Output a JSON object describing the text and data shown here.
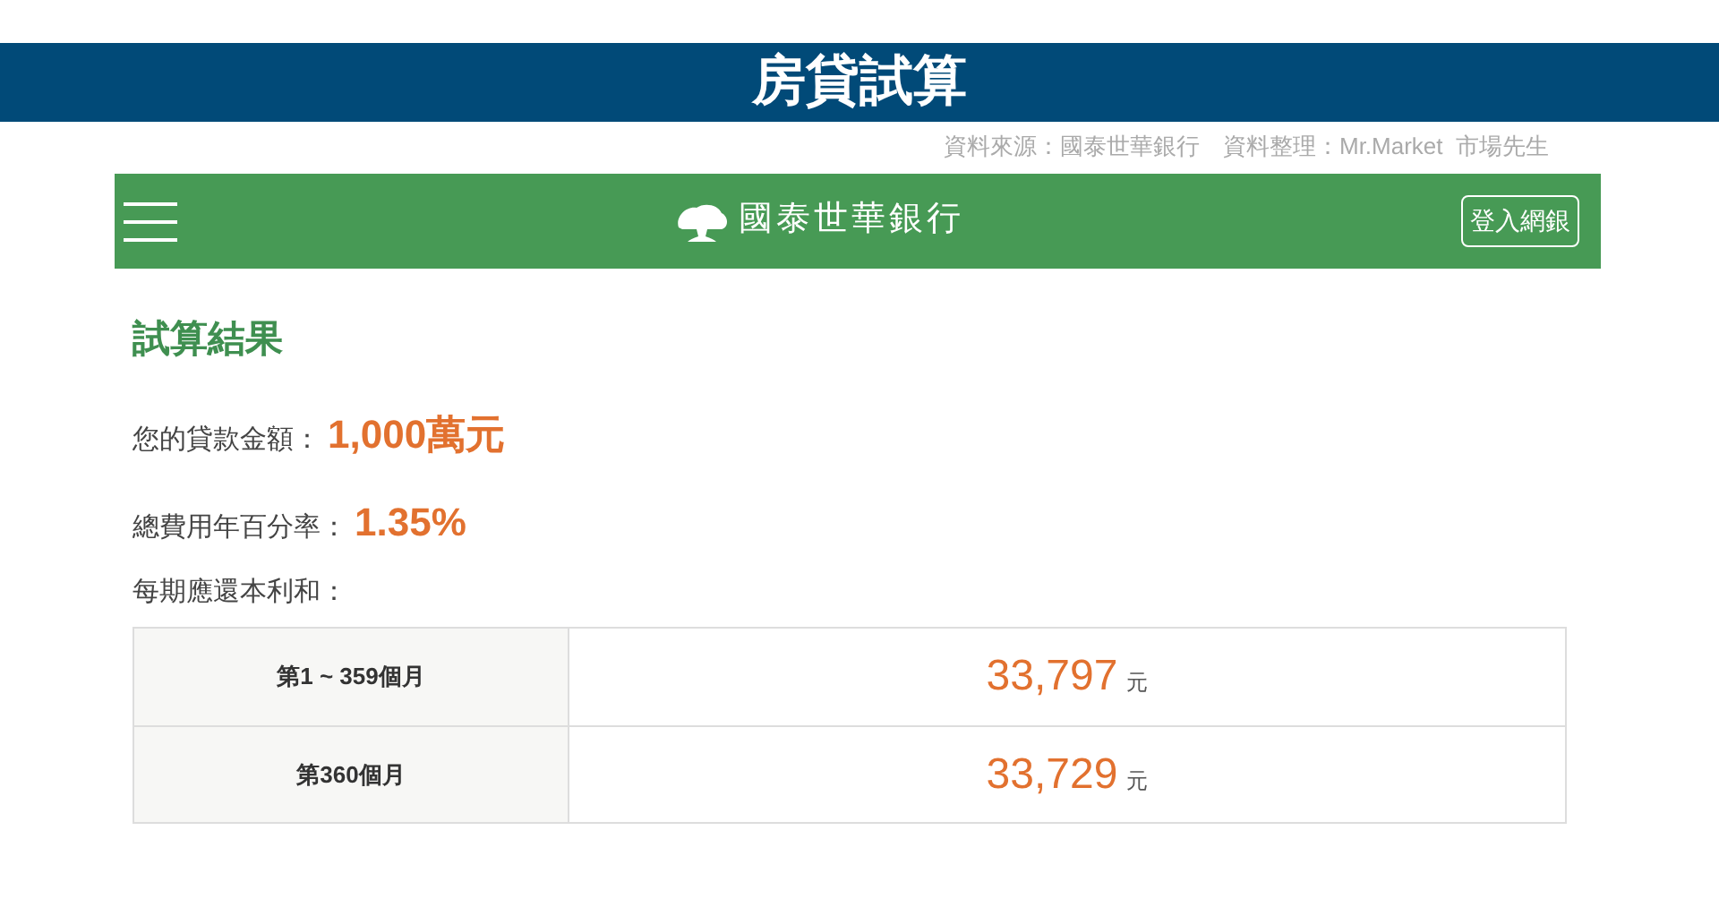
{
  "banner": {
    "title": "房貸試算"
  },
  "source_note": "資料來源：國泰世華銀行　資料整理：Mr.Market  市場先生",
  "navbar": {
    "brand": "國泰世華銀行",
    "login_button": "登入網銀"
  },
  "result": {
    "heading": "試算結果",
    "fields": [
      {
        "label": "您的貸款金額：",
        "value": "1,000萬元"
      },
      {
        "label": "總費用年百分率：",
        "value": "1.35%"
      }
    ],
    "payment_label": "每期應還本利和：",
    "table": {
      "rows": [
        {
          "period": "第1 ~ 359個月",
          "amount": "33,797",
          "unit": "元"
        },
        {
          "period": "第360個月",
          "amount": "33,729",
          "unit": "元"
        }
      ]
    }
  }
}
